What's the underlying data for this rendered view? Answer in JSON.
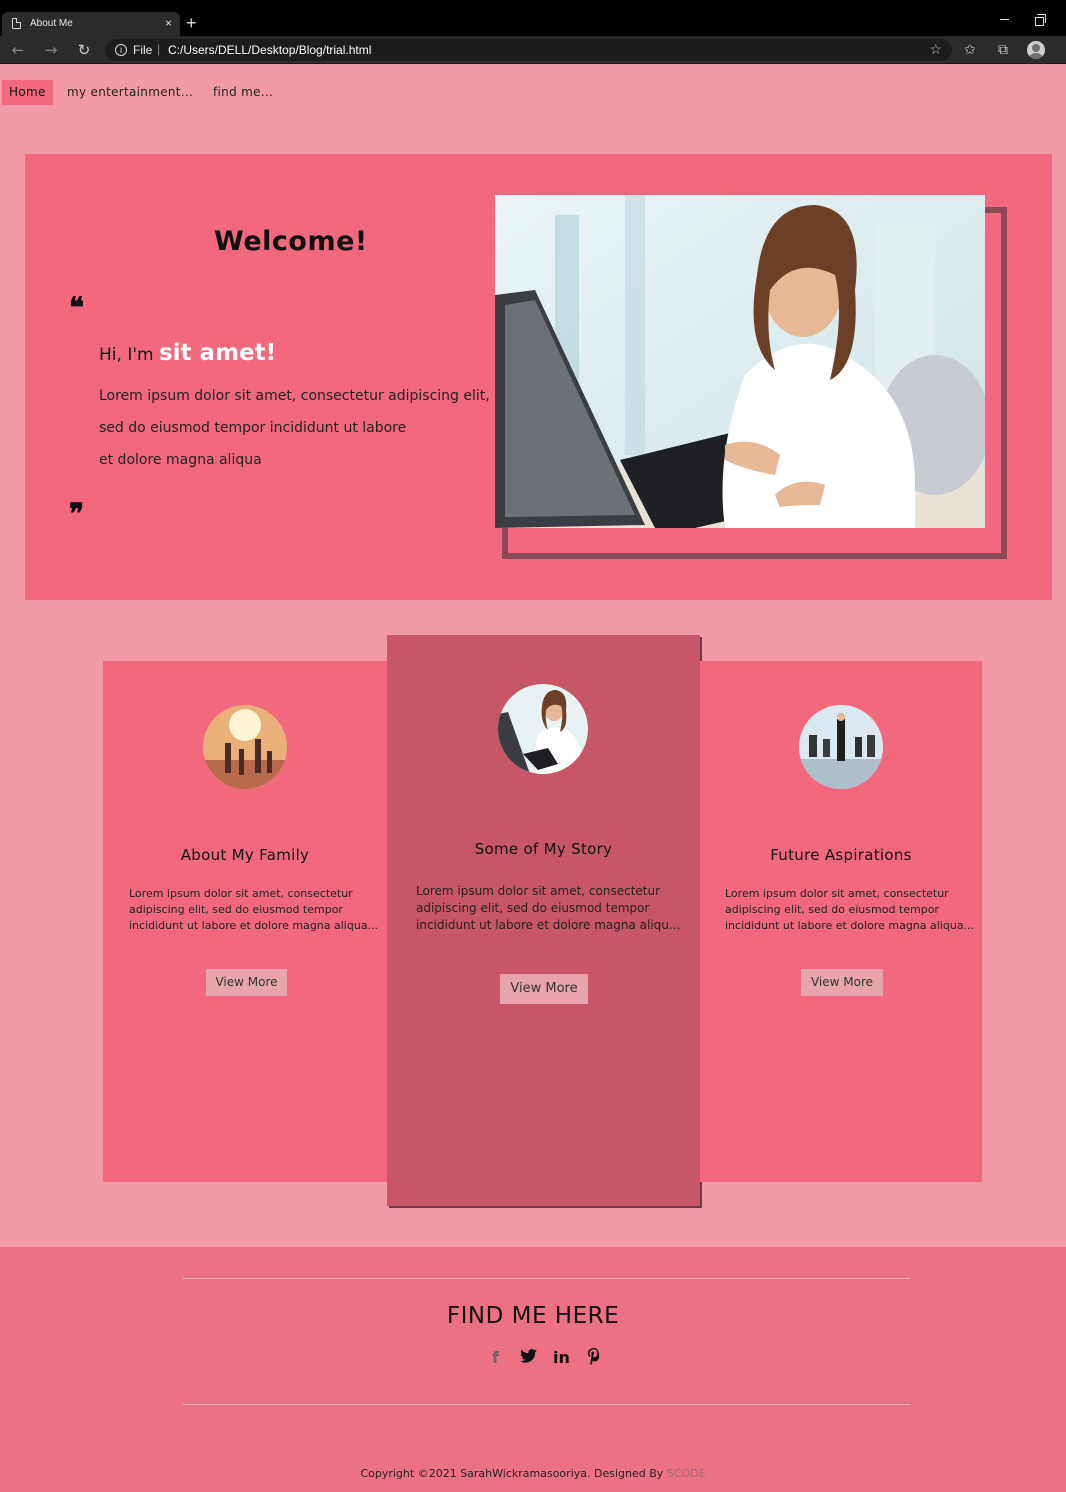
{
  "browser": {
    "tab_title": "About Me",
    "tab_close": "×",
    "new_tab": "+",
    "address_scheme": "File",
    "address_url": "C:/Users/DELL/Desktop/Blog/trial.html"
  },
  "nav": {
    "items": [
      {
        "label": "Home",
        "active": true
      },
      {
        "label": "my entertainment..."
      },
      {
        "label": "find me..."
      }
    ]
  },
  "hero": {
    "title": "Welcome!",
    "greeting_prefix": "Hi, I'm",
    "greeting_name": "sit amet!",
    "lines": [
      "Lorem ipsum dolor sit amet, consectetur adipiscing elit,",
      "sed do eiusmod tempor incididunt ut labore",
      "et dolore magna aliqua"
    ]
  },
  "cards": [
    {
      "title": "About My Family",
      "description": "Lorem ipsum dolor sit amet, consectetur adipiscing elit, sed do eiusmod tempor incididunt ut labore et dolore magna aliqua...",
      "button": "View More"
    },
    {
      "title": "Some of My Story",
      "description": "Lorem ipsum dolor sit amet, consectetur adipiscing elit, sed do eiusmod tempor incididunt ut labore et dolore magna aliqu...",
      "button": "View More"
    },
    {
      "title": "Future Aspirations",
      "description": "Lorem ipsum dolor sit amet, consectetur adipiscing elit, sed do eiusmod tempor incididunt ut labore et dolore magna aliqua...",
      "button": "View More"
    }
  ],
  "footer": {
    "heading": "FIND ME HERE",
    "socials": [
      "facebook-icon",
      "twitter-icon",
      "linkedin-icon",
      "pinterest-icon"
    ],
    "copyright": "Copyright ©2021 SarahWickramasooriya. Designed By",
    "brand": "SCODE"
  },
  "colors": {
    "page_bg": "#f29ba6",
    "hero_bg": "#f2687d",
    "center_card": "#c75666",
    "footer_bg": "#ec7283",
    "button_bg": "#e7a4ad"
  }
}
